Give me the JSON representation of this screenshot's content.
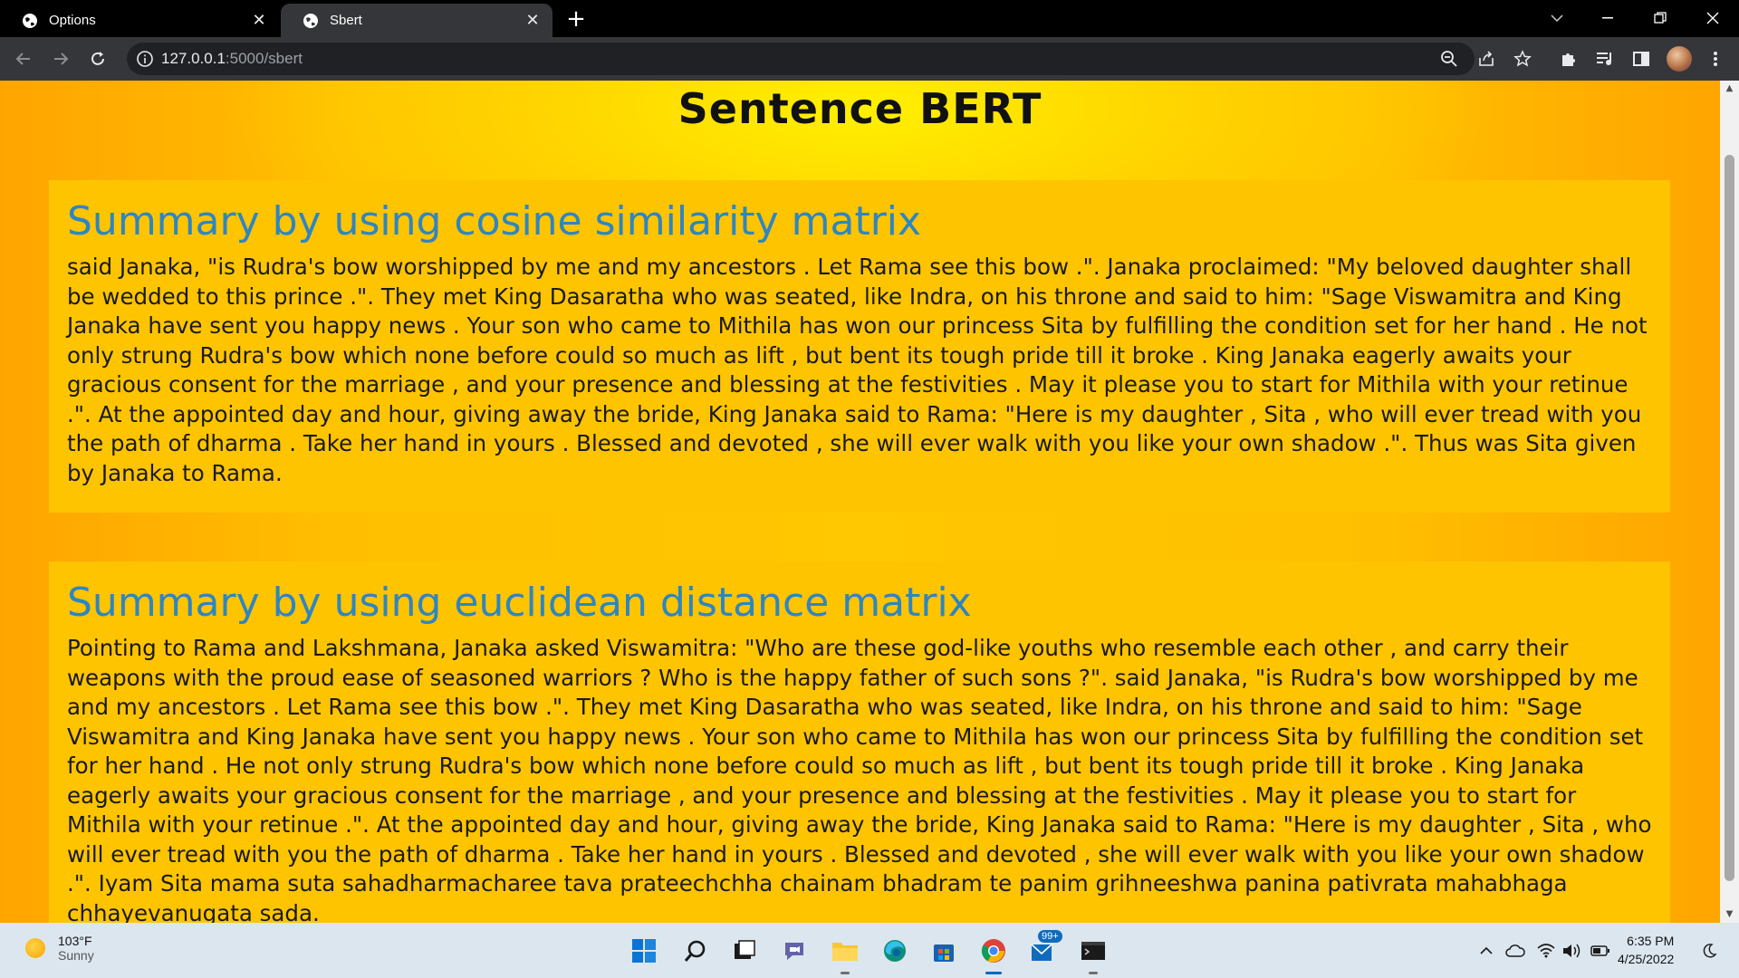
{
  "browser": {
    "tabs": [
      {
        "title": "Options",
        "active": false
      },
      {
        "title": "Sbert",
        "active": true
      }
    ],
    "url_host": "127.0.0.1",
    "url_path": ":5000/sbert"
  },
  "page": {
    "title": "Sentence BERT",
    "sections": [
      {
        "heading": "Summary by using cosine similarity matrix",
        "text": "said Janaka, \"is Rudra's bow worshipped by me and my ancestors . Let Rama see this bow .\". Janaka proclaimed: \"My beloved daughter shall be wedded to this prince .\". They met King Dasaratha who was seated, like Indra, on his throne and said to him: \"Sage Viswamitra and King Janaka have sent you happy news . Your son who came to Mithila has won our princess Sita by fulfilling the condition set for her hand . He not only strung Rudra's bow which none before could so much as lift , but bent its tough pride till it broke . King Janaka eagerly awaits your gracious consent for the marriage , and your presence and blessing at the festivities . May it please you to start for Mithila with your retinue .\". At the appointed day and hour, giving away the bride, King Janaka said to Rama: \"Here is my daughter , Sita , who will ever tread with you the path of dharma . Take her hand in yours . Blessed and devoted , she will ever walk with you like your own shadow .\". Thus was Sita given by Janaka to Rama."
      },
      {
        "heading": "Summary by using euclidean distance matrix",
        "text": "Pointing to Rama and Lakshmana, Janaka asked Viswamitra: \"Who are these god-like youths who resemble each other , and carry their weapons with the proud ease of seasoned warriors ? Who is the happy father of such sons ?\". said Janaka, \"is Rudra's bow worshipped by me and my ancestors . Let Rama see this bow .\". They met King Dasaratha who was seated, like Indra, on his throne and said to him: \"Sage Viswamitra and King Janaka have sent you happy news . Your son who came to Mithila has won our princess Sita by fulfilling the condition set for her hand . He not only strung Rudra's bow which none before could so much as lift , but bent its tough pride till it broke . King Janaka eagerly awaits your gracious consent for the marriage , and your presence and blessing at the festivities . May it please you to start for Mithila with your retinue .\". At the appointed day and hour, giving away the bride, King Janaka said to Rama: \"Here is my daughter , Sita , who will ever tread with you the path of dharma . Take her hand in yours . Blessed and devoted , she will ever walk with you like your own shadow .\". Iyam Sita mama suta sahadharmacharee tava prateechchha chainam bhadram te panim grihneeshwa panina pativrata mahabhaga chhayevanugata sada."
      }
    ]
  },
  "taskbar": {
    "weather_temp": "103°F",
    "weather_condition": "Sunny",
    "mail_badge": "99+",
    "time": "6:35 PM",
    "date": "4/25/2022"
  },
  "colors": {
    "heading": "#2e86c1",
    "card": "#ffc400",
    "page_bg": "#ffbf00"
  }
}
